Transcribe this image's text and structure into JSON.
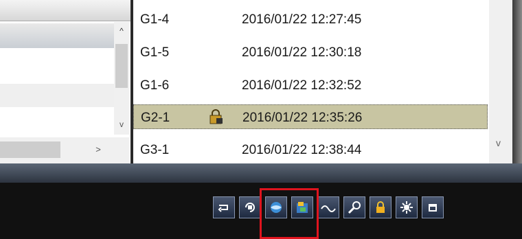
{
  "list": {
    "rows": [
      {
        "name": "G1-4",
        "datetime": "2016/01/22  12:27:45",
        "locked": false,
        "selected": false
      },
      {
        "name": "G1-5",
        "datetime": "2016/01/22  12:30:18",
        "locked": false,
        "selected": false
      },
      {
        "name": "G1-6",
        "datetime": "2016/01/22  12:32:52",
        "locked": false,
        "selected": false
      },
      {
        "name": "G2-1",
        "datetime": "2016/01/22  12:35:26",
        "locked": true,
        "selected": true
      },
      {
        "name": "G3-1",
        "datetime": "2016/01/22  12:38:44",
        "locked": false,
        "selected": false
      }
    ]
  },
  "scroll": {
    "up_glyph": "^",
    "down_glyph": "v",
    "right_glyph": ">"
  },
  "toolbar": {
    "buttons": [
      {
        "icon": "repeat-icon"
      },
      {
        "icon": "rotate-camera-icon"
      },
      {
        "icon": "globe-icon"
      },
      {
        "icon": "export-clip-icon"
      },
      {
        "icon": "waveform-icon"
      },
      {
        "icon": "search-key-icon"
      },
      {
        "icon": "lock-icon"
      },
      {
        "icon": "brightness-icon"
      },
      {
        "icon": "window-icon"
      }
    ]
  },
  "colors": {
    "selection": "#c8c5a2",
    "highlight": "#e0141e",
    "toolbar_button": "#2a3752"
  }
}
